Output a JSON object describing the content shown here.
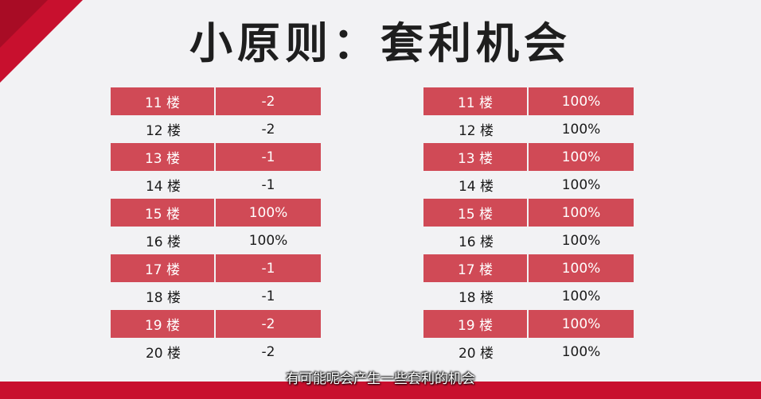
{
  "title": "小原则：套利机会",
  "subtitle": "有可能呢会产生一些套利的机会",
  "colors": {
    "accent": "#c8102e",
    "row_highlight": "#d04a56"
  },
  "left_table": [
    {
      "floor": "11 楼",
      "value": "-2"
    },
    {
      "floor": "12 楼",
      "value": "-2"
    },
    {
      "floor": "13 楼",
      "value": "-1"
    },
    {
      "floor": "14 楼",
      "value": "-1"
    },
    {
      "floor": "15 楼",
      "value": "100%"
    },
    {
      "floor": "16 楼",
      "value": "100%"
    },
    {
      "floor": "17 楼",
      "value": "-1"
    },
    {
      "floor": "18 楼",
      "value": "-1"
    },
    {
      "floor": "19 楼",
      "value": "-2"
    },
    {
      "floor": "20 楼",
      "value": "-2"
    }
  ],
  "right_table": [
    {
      "floor": "11 楼",
      "value": "100%"
    },
    {
      "floor": "12 楼",
      "value": "100%"
    },
    {
      "floor": "13 楼",
      "value": "100%"
    },
    {
      "floor": "14 楼",
      "value": "100%"
    },
    {
      "floor": "15 楼",
      "value": "100%"
    },
    {
      "floor": "16 楼",
      "value": "100%"
    },
    {
      "floor": "17 楼",
      "value": "100%"
    },
    {
      "floor": "18 楼",
      "value": "100%"
    },
    {
      "floor": "19 楼",
      "value": "100%"
    },
    {
      "floor": "20 楼",
      "value": "100%"
    }
  ]
}
